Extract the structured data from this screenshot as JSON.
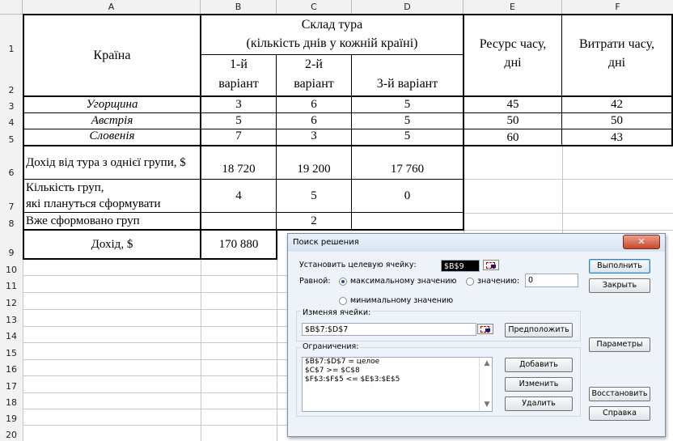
{
  "columns": [
    "A",
    "B",
    "C",
    "D",
    "E",
    "F"
  ],
  "rows": [
    "1",
    "2",
    "3",
    "4",
    "5",
    "6",
    "7",
    "8",
    "9",
    "10",
    "11",
    "12",
    "13",
    "14",
    "15",
    "16",
    "17",
    "18",
    "19",
    "20"
  ],
  "table": {
    "header": {
      "country": "Країна",
      "composition_line1": "Склад тура",
      "composition_line2": "(кількість днів у кожній країні)",
      "var1_line1": "1-й",
      "var1_line2": "варіант",
      "var2_line1": "2-й",
      "var2_line2": "варіант",
      "var3": "3-й варіант",
      "resource_line1": "Ресурс часу,",
      "resource_line2": "дні",
      "spend_line1": "Витрати часу,",
      "spend_line2": "дні"
    },
    "countries": [
      {
        "name": "Угорщина",
        "v1": "3",
        "v2": "6",
        "v3": "5",
        "resource": "45",
        "spend": "42"
      },
      {
        "name": "Австрія",
        "v1": "5",
        "v2": "6",
        "v3": "5",
        "resource": "50",
        "spend": "50"
      },
      {
        "name": "Словенія",
        "v1": "7",
        "v2": "3",
        "v3": "5",
        "resource": "60",
        "spend": "43"
      }
    ],
    "income_label": "Дохід від тура з однієї групи, $",
    "income": [
      "18 720",
      "19 200",
      "17 760"
    ],
    "groups_label_line1": "Кількість груп,",
    "groups_label_line2": "які плануться сформувати",
    "groups": [
      "4",
      "5",
      "0"
    ],
    "formed_label": "Вже сформовано груп",
    "formed": [
      "",
      "2",
      ""
    ],
    "total_label": "Дохід, $",
    "total": "170 880"
  },
  "dialog": {
    "title": "Поиск решения",
    "close": "✕",
    "target_label": "Установить целевую ячейку:",
    "target_value": "$B$9",
    "equal_label": "Равной:",
    "max_label": "максимальному значению",
    "value_label": "значению:",
    "value_input": "0",
    "min_label": "минимальному значению",
    "changing_label": "Изменяя ячейки:",
    "changing_value": "$B$7:$D$7",
    "guess_button": "Предположить",
    "constraints_label": "Ограничения:",
    "constraints": [
      "$B$7:$D$7 = целое",
      "$C$7 >= $C$8",
      "$F$3:$F$5 <= $E$3:$E$5"
    ],
    "add_button": "Добавить",
    "change_button": "Изменить",
    "delete_button": "Удалить",
    "solve_button": "Выполнить",
    "close_button": "Закрыть",
    "options_button": "Параметры",
    "reset_button": "Восстановить",
    "help_button": "Справка"
  }
}
